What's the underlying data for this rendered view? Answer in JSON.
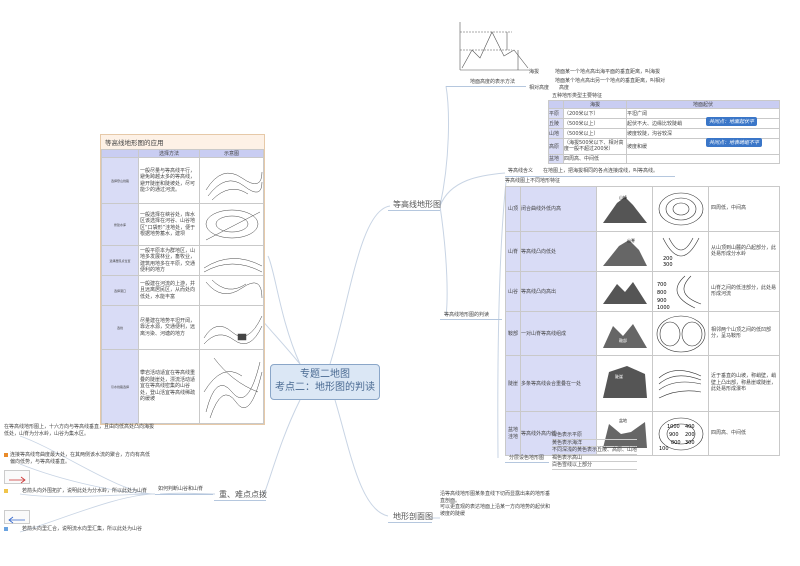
{
  "center": {
    "line1": "专题二地图",
    "line2": "考点二：地形图的判读"
  },
  "branches": {
    "contour_map": "等高线地形图",
    "key_points": "重、难点点拨",
    "profile": "地形剖面图"
  },
  "height_methods": {
    "label": "地面高度的表示方法",
    "altitude_term": "海拔",
    "altitude_def": "地面某一个地点高出海平面的垂直距离，叫海拔",
    "relative_line1": "地面某个地点高出另一个地点的垂直距离，叫相对",
    "relative_line2": "相对高度　　高度"
  },
  "terrain_types": {
    "title": "五种地形类型主要特征",
    "headers": [
      "海拔",
      "地面起伏"
    ],
    "rows": [
      {
        "name": "平原",
        "alt": "（200米以下）",
        "relief": "平坦广阔"
      },
      {
        "name": "丘陵",
        "alt": "（500米以上）",
        "relief": "起伏不大、边缘比较陡峭"
      },
      {
        "name": "山地",
        "alt": "（500米以上）",
        "relief": "坡度较陡，沟谷较深"
      },
      {
        "name": "高原",
        "alt": "（海拔500米以下、相对高度一般不超过200米）",
        "relief": "坡度和缓"
      },
      {
        "name": "盆地",
        "alt": "四周高、中间低",
        "relief": ""
      }
    ],
    "badge1": "共同点：地面起伏平",
    "badge2": "共同点：地表崎岖不平"
  },
  "contour_def": "等高线含义　　在地图上，把海拔相同的各点连接成线，叫等高线。",
  "landforms": {
    "title": "等高线地形图的判读",
    "table_title": "等高线图上不同地形特征",
    "rows": [
      {
        "name": "山顶",
        "feature": "闭合曲线外低内高",
        "note": "四周低，中间高"
      },
      {
        "name": "山脊",
        "feature": "等高线凸向低处",
        "note": "从山顶到山麓的凸起部分，此处易形成分水岭"
      },
      {
        "name": "山谷",
        "feature": "等高线凸向高出",
        "note": "山脊之间的低洼部分，此处易形成河流"
      },
      {
        "name": "鞍部",
        "feature": "一对山脊等高线组成",
        "note": "相邻两个山顶之间的低凹部分，呈马鞍形"
      },
      {
        "name": "陡崖",
        "feature": "多条等高线会合重叠在一处",
        "note": "近于垂直的山坡，称峭壁，峭壁上凸出部，称悬崖或陡崖，此处易形成瀑布"
      },
      {
        "name": "盆地洼地",
        "feature": "等高线外高内低",
        "note": "四周高、中间低"
      }
    ],
    "fig_labels": {
      "peak": "山峰",
      "ridge": "山脊",
      "saddle": "鞍部",
      "cliff": "陡崖",
      "basin": "盆地"
    },
    "contour_values": [
      "700",
      "800",
      "900",
      "1000",
      "200",
      "300",
      "100",
      "1000",
      "900",
      "800",
      "200",
      "300",
      "400"
    ]
  },
  "layered": {
    "label": "分层设色地形图",
    "items": [
      "绿色表示平原",
      "黄色表示海洋",
      "不同深浅的黄色表示丘陵、高原、山地",
      "褐色表示高山",
      "白色雪线以上部分"
    ]
  },
  "profile_text": [
    "沿等高线地形图某条直线下切而显露出来的地形垂",
    "直剖面。",
    "可以更直观的表达地面上沿某一方向地势的起伏和",
    "坡度的陡缓"
  ],
  "applications": {
    "title": "等高线地形图的应用",
    "headers": [
      "选择方法",
      "示意图"
    ],
    "rows": [
      {
        "name": "选择登山线路",
        "method": "一般尽量与等高线平行，避免跨越太多的等高线，避开陡崖和陡坡处，尽可能少的通过河流。"
      },
      {
        "name": "修建水库",
        "method": "一般选择在峡谷处，库水区该选择在河谷、山谷地区“口袋形”洼地处，便于根据地势蓄水，建坝"
      },
      {
        "name": "选择居民点位置",
        "method": "一般平原本为群地区，山地多发展林业，畜牧业，建筑用地多在平原，交通便利的地方"
      },
      {
        "name": "选择港口",
        "method": "一般建在河流的上游，并且远离居民区，从而处向低处，水能丰富"
      },
      {
        "name": "选线",
        "method": "尽量建在地势平坦开阔，靠近水源，交通便利，远离污染、河塘的地方"
      },
      {
        "name": "引水线路选择",
        "method": "攀岩活动适宜在等高线重叠的陡崖处，漂流活动适宜在等高线密集的山谷处，登山活宜等高线稀疏的缓坡"
      }
    ]
  },
  "key_points": {
    "label": "如何判断山谷和山脊",
    "items": [
      "在等高线地形图上，十六方向与等高线垂直，且由向低高处凸向海拔低处，山脊为分水岭，山谷为集水区。",
      "连接等高线弯曲度最大处，在其两侧该水流的聚合，方向有高低偏向低势，与等高线垂直。",
      "若箭头向外围拓扩，说明此处为分水岭，所以此处为山脊",
      "若箭头向里汇合，说明流水向里汇集，所以此处为山谷"
    ]
  },
  "colors": {
    "accent": "#3a76c8",
    "branch_line": "#b5c7de",
    "table_header": "#c9cdf2"
  }
}
